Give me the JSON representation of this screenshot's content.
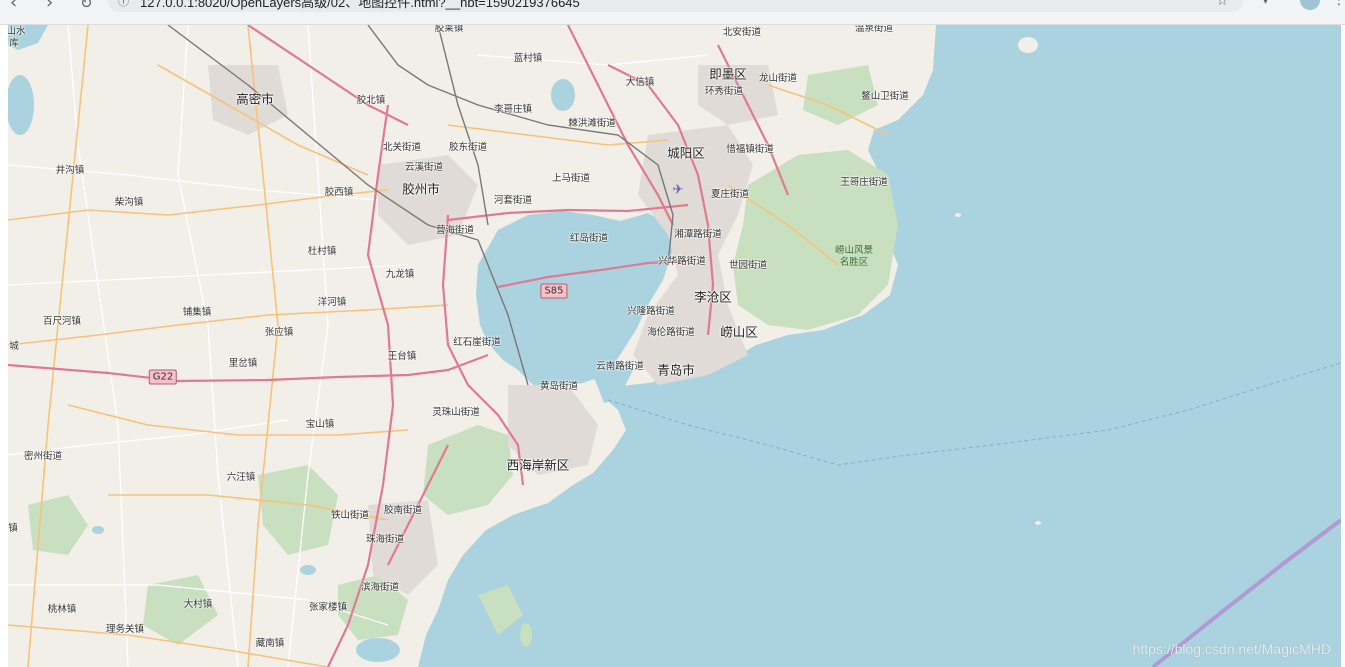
{
  "browser": {
    "url": "127.0.0.1:8020/OpenLayers高级/02、地图控件.html?__hbt=1590219376645"
  },
  "map": {
    "colors": {
      "land": "#f2efe9",
      "sea": "#aad3df",
      "forest": "#c8dfc0",
      "urban": "#e0dbd6",
      "motorway": "#e07a92",
      "primary": "#f7c27a",
      "minor": "#ffffff",
      "rail": "#777777",
      "boundary": "#8e5ea2"
    },
    "place_labels": [
      {
        "id": "gaomi",
        "text": "高密市",
        "kind": "city"
      },
      {
        "id": "jiaozhou",
        "text": "胶州市",
        "kind": "city"
      },
      {
        "id": "chengyang",
        "text": "城阳区",
        "kind": "city"
      },
      {
        "id": "jimo",
        "text": "即墨区",
        "kind": "city"
      },
      {
        "id": "licang",
        "text": "李沧区",
        "kind": "city"
      },
      {
        "id": "laoshan",
        "text": "崂山区",
        "kind": "city"
      },
      {
        "id": "qingdao",
        "text": "青岛市",
        "kind": "city"
      },
      {
        "id": "xihaian",
        "text": "西海岸新区",
        "kind": "city"
      },
      {
        "id": "shanshui",
        "text": "山水",
        "kind": "town"
      },
      {
        "id": "ku",
        "text": "库",
        "kind": "town"
      },
      {
        "id": "jiaolai",
        "text": "胶莱镇",
        "kind": "town"
      },
      {
        "id": "lanxin",
        "text": "蓝村镇",
        "kind": "town"
      },
      {
        "id": "beian",
        "text": "北安街道",
        "kind": "town"
      },
      {
        "id": "wenquan",
        "text": "温泉街道",
        "kind": "town"
      },
      {
        "id": "daxin",
        "text": "大信镇",
        "kind": "town"
      },
      {
        "id": "longshan",
        "text": "龙山街道",
        "kind": "town"
      },
      {
        "id": "huanxiu",
        "text": "环秀街道",
        "kind": "town"
      },
      {
        "id": "aoshanwei",
        "text": "鳌山卫街道",
        "kind": "town"
      },
      {
        "id": "jiaobei",
        "text": "胶北镇",
        "kind": "town"
      },
      {
        "id": "ligezhuang",
        "text": "李哥庄镇",
        "kind": "town"
      },
      {
        "id": "jihongtan",
        "text": "棘洪滩街道",
        "kind": "town"
      },
      {
        "id": "beiguan",
        "text": "北关街道",
        "kind": "town"
      },
      {
        "id": "jiaodong",
        "text": "胶东街道",
        "kind": "town"
      },
      {
        "id": "yunxi",
        "text": "云溪街道",
        "kind": "town"
      },
      {
        "id": "xifu",
        "text": "惜福镇街道",
        "kind": "town"
      },
      {
        "id": "jinggou",
        "text": "井沟镇",
        "kind": "town"
      },
      {
        "id": "jiaoxi",
        "text": "胶西镇",
        "kind": "town"
      },
      {
        "id": "shangma",
        "text": "上马街道",
        "kind": "town"
      },
      {
        "id": "xiazhuang",
        "text": "夏庄街道",
        "kind": "town"
      },
      {
        "id": "wanggezhuang",
        "text": "王哥庄街道",
        "kind": "town"
      },
      {
        "id": "chaigou",
        "text": "柴沟镇",
        "kind": "town"
      },
      {
        "id": "hetao",
        "text": "河套街道",
        "kind": "town"
      },
      {
        "id": "yinghai",
        "text": "营海街道",
        "kind": "town"
      },
      {
        "id": "hongdao",
        "text": "红岛街道",
        "kind": "town"
      },
      {
        "id": "xiangtan",
        "text": "湘潭路街道",
        "kind": "town"
      },
      {
        "id": "dujia",
        "text": "杜村镇",
        "kind": "town"
      },
      {
        "id": "laoshanpark",
        "text": "崂山风景\n名胜区",
        "kind": "park"
      },
      {
        "id": "xinghua",
        "text": "兴华路街道",
        "kind": "town"
      },
      {
        "id": "shiyuan",
        "text": "世园街道",
        "kind": "town"
      },
      {
        "id": "jiulong",
        "text": "九龙镇",
        "kind": "town"
      },
      {
        "id": "yangkou",
        "text": "洋河镇",
        "kind": "town"
      },
      {
        "id": "xinglong",
        "text": "兴隆路街道",
        "kind": "town"
      },
      {
        "id": "puji",
        "text": "铺集镇",
        "kind": "town"
      },
      {
        "id": "baichi",
        "text": "百尺河镇",
        "kind": "town"
      },
      {
        "id": "zhangying",
        "text": "张应镇",
        "kind": "town"
      },
      {
        "id": "hailun",
        "text": "海伦路街道",
        "kind": "town"
      },
      {
        "id": "hongshiya",
        "text": "红石崖街道",
        "kind": "town"
      },
      {
        "id": "cheng",
        "text": "城",
        "kind": "town"
      },
      {
        "id": "wangtai",
        "text": "王台镇",
        "kind": "town"
      },
      {
        "id": "licha",
        "text": "里岔镇",
        "kind": "town"
      },
      {
        "id": "yunnan",
        "text": "云南路街道",
        "kind": "town"
      },
      {
        "id": "huangdao",
        "text": "黄岛街道",
        "kind": "town"
      },
      {
        "id": "lingzhushan",
        "text": "灵珠山街道",
        "kind": "town"
      },
      {
        "id": "baoshan",
        "text": "宝山镇",
        "kind": "town"
      },
      {
        "id": "mizhou",
        "text": "密州街道",
        "kind": "town"
      },
      {
        "id": "liuwang",
        "text": "六汪镇",
        "kind": "town"
      },
      {
        "id": "tieshan",
        "text": "铁山街道",
        "kind": "town"
      },
      {
        "id": "jiaonan",
        "text": "胶南街道",
        "kind": "town"
      },
      {
        "id": "zhen",
        "text": "镇",
        "kind": "town"
      },
      {
        "id": "zhuhai",
        "text": "珠海街道",
        "kind": "town"
      },
      {
        "id": "binhai",
        "text": "滨海街道",
        "kind": "town"
      },
      {
        "id": "dacun",
        "text": "大村镇",
        "kind": "town"
      },
      {
        "id": "zhangjialou",
        "text": "张家楼镇",
        "kind": "town"
      },
      {
        "id": "taolin",
        "text": "桃林镇",
        "kind": "town"
      },
      {
        "id": "liwuguan",
        "text": "理务关镇",
        "kind": "town"
      },
      {
        "id": "cangnan",
        "text": "藏南镇",
        "kind": "town"
      }
    ],
    "road_shields": [
      {
        "id": "s85",
        "text": "S85"
      },
      {
        "id": "g22",
        "text": "G22"
      }
    ],
    "icons": [
      "airport-icon"
    ],
    "watermark": "https://blog.csdn.net/MagicMHD"
  }
}
